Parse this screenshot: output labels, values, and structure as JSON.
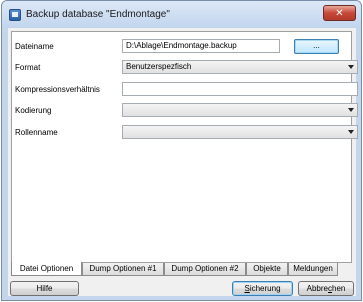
{
  "window": {
    "title": "Backup database \"Endmontage\"",
    "close_glyph": "✕"
  },
  "form": {
    "dateiname": {
      "label": "Dateiname",
      "value": "D:\\Ablage\\Endmontage.backup",
      "browse_label": "..."
    },
    "format": {
      "label": "Format",
      "selected": "Benutzerspezfisch"
    },
    "kompression": {
      "label": "Kompressionsverhältnis",
      "value": ""
    },
    "kodierung": {
      "label": "Kodierung",
      "selected": ""
    },
    "rollenname": {
      "label": "Rollenname",
      "selected": ""
    }
  },
  "tabs": [
    {
      "label": "Datei Optionen",
      "active": true
    },
    {
      "label": "Dump Optionen #1",
      "active": false
    },
    {
      "label": "Dump Optionen #2",
      "active": false
    },
    {
      "label": "Objekte",
      "active": false
    },
    {
      "label": "Meldungen",
      "active": false
    }
  ],
  "buttons": {
    "hilfe": "Hilfe",
    "sicherung_u": "S",
    "sicherung_rest": "icherung",
    "abbrechen_a": "Abbre",
    "abbrechen_u": "c",
    "abbrechen_b": "hen"
  },
  "icons": {
    "app": "database-backup-icon",
    "close": "close-icon",
    "dropdown": "chevron-down-icon"
  },
  "colors": {
    "title_bar": "#c4d6ec",
    "close_button": "#c7483a",
    "default_button_border": "#3c7fb1"
  }
}
